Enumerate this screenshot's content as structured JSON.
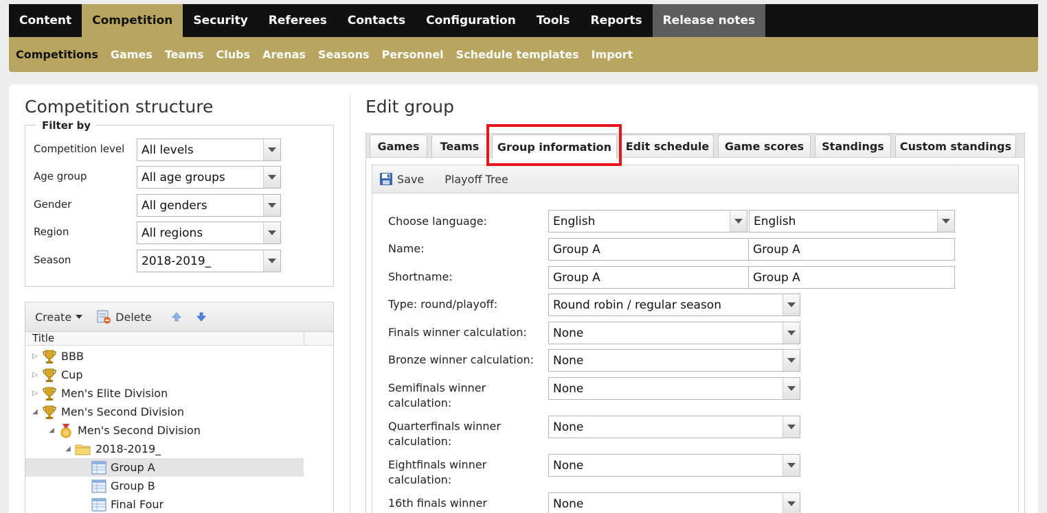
{
  "topnav": {
    "items": [
      "Content",
      "Competition",
      "Security",
      "Referees",
      "Contacts",
      "Configuration",
      "Tools",
      "Reports",
      "Release notes"
    ]
  },
  "subnav": {
    "items": [
      "Competitions",
      "Games",
      "Teams",
      "Clubs",
      "Arenas",
      "Seasons",
      "Personnel",
      "Schedule templates",
      "Import"
    ]
  },
  "left": {
    "title": "Competition structure",
    "filter": {
      "legend": "Filter by",
      "rows": [
        {
          "label": "Competition level",
          "value": "All levels"
        },
        {
          "label": "Age group",
          "value": "All age groups"
        },
        {
          "label": "Gender",
          "value": "All genders"
        },
        {
          "label": "Region",
          "value": "All regions"
        },
        {
          "label": "Season",
          "value": "2018-2019_"
        }
      ]
    },
    "tree": {
      "toolbar": {
        "create": "Create",
        "delete": "Delete"
      },
      "column_title": "Title",
      "rows": [
        {
          "label": "BBB",
          "icon": "trophy-icon"
        },
        {
          "label": "Cup",
          "icon": "trophy-icon"
        },
        {
          "label": "Men's Elite Division",
          "icon": "trophy-icon"
        },
        {
          "label": "Men's Second Division",
          "icon": "trophy-icon"
        },
        {
          "label": "Men's Second Division",
          "icon": "medal-icon"
        },
        {
          "label": "2018-2019_",
          "icon": "folder-icon"
        },
        {
          "label": "Group A",
          "icon": "table-icon"
        },
        {
          "label": "Group B",
          "icon": "table-icon"
        },
        {
          "label": "Final Four",
          "icon": "table-icon"
        }
      ]
    }
  },
  "right": {
    "title": "Edit group",
    "tabs": [
      "Games",
      "Teams",
      "Group information",
      "Edit schedule",
      "Game scores",
      "Standings",
      "Custom standings"
    ],
    "active_tab": "Group information",
    "toolbar": {
      "save": "Save",
      "playoff_tree": "Playoff Tree"
    },
    "form": {
      "language": {
        "label": "Choose language:",
        "value1": "English",
        "value2": "English"
      },
      "name": {
        "label": "Name:",
        "value1": "Group A",
        "value2": "Group A"
      },
      "shortname": {
        "label": "Shortname:",
        "value1": "Group A",
        "value2": "Group A"
      },
      "type": {
        "label": "Type: round/playoff:",
        "value": "Round robin / regular season"
      },
      "finals": {
        "label": "Finals winner calculation:",
        "value": "None"
      },
      "bronze": {
        "label": "Bronze winner calculation:",
        "value": "None"
      },
      "semifinals": {
        "label": "Semifinals winner calculation:",
        "value": "None"
      },
      "quarterfinals": {
        "label": "Quarterfinals winner calculation:",
        "value": "None"
      },
      "eightfinals": {
        "label": "Eightfinals winner calculation:",
        "value": "None"
      },
      "sixteenth": {
        "label": "16th finals winner",
        "value": "None"
      }
    }
  }
}
